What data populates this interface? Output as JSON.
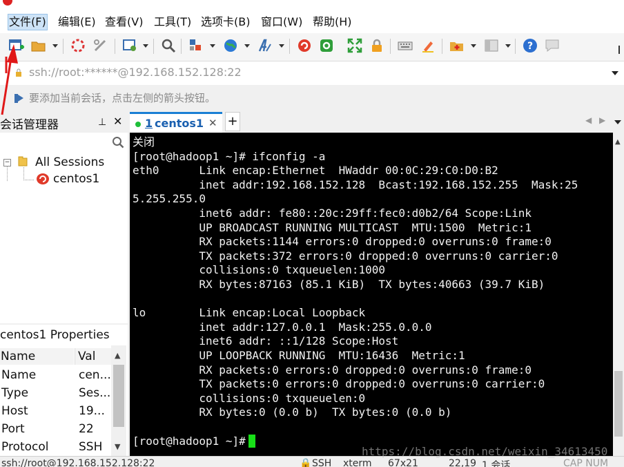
{
  "menu": [
    "文件(F)",
    "编辑(E)",
    "查看(V)",
    "工具(T)",
    "选项卡(B)",
    "窗口(W)",
    "帮助(H)"
  ],
  "address": {
    "value": "ssh://root:******@192.168.152.128:22"
  },
  "hint": "要添加当前会话，点击左侧的箭头按钮。",
  "session_manager": {
    "title": "会话管理器",
    "pin_glyph": "⊥",
    "close_glyph": "✕",
    "root": "All Sessions",
    "sessions": [
      "centos1"
    ]
  },
  "properties": {
    "title": "centos1 Properties",
    "headers": [
      "Name",
      "Val"
    ],
    "rows": [
      {
        "name": "Name",
        "value": "cen..."
      },
      {
        "name": "Type",
        "value": "Ses..."
      },
      {
        "name": "Host",
        "value": "19..."
      },
      {
        "name": "Port",
        "value": "22"
      },
      {
        "name": "Protocol",
        "value": "SSH"
      }
    ]
  },
  "tab": {
    "number": "1",
    "label": "centos1",
    "close_glyph": "✕",
    "add_glyph": "+"
  },
  "terminal": {
    "lines": [
      "关闭",
      "[root@hadoop1 ~]# ifconfig -a",
      "eth0      Link encap:Ethernet  HWaddr 00:0C:29:C0:D0:B2  ",
      "          inet addr:192.168.152.128  Bcast:192.168.152.255  Mask:25",
      "5.255.255.0",
      "          inet6 addr: fe80::20c:29ff:fec0:d0b2/64 Scope:Link",
      "          UP BROADCAST RUNNING MULTICAST  MTU:1500  Metric:1",
      "          RX packets:1144 errors:0 dropped:0 overruns:0 frame:0",
      "          TX packets:372 errors:0 dropped:0 overruns:0 carrier:0",
      "          collisions:0 txqueuelen:1000 ",
      "          RX bytes:87163 (85.1 KiB)  TX bytes:40663 (39.7 KiB)",
      "",
      "lo        Link encap:Local Loopback  ",
      "          inet addr:127.0.0.1  Mask:255.0.0.0",
      "          inet6 addr: ::1/128 Scope:Host",
      "          UP LOOPBACK RUNNING  MTU:16436  Metric:1",
      "          RX packets:0 errors:0 dropped:0 overruns:0 frame:0",
      "          TX packets:0 errors:0 dropped:0 overruns:0 carrier:0",
      "          collisions:0 txqueuelen:0 ",
      "          RX bytes:0 (0.0 b)  TX bytes:0 (0.0 b)"
    ],
    "prompt": "[root@hadoop1 ~]#"
  },
  "status": {
    "connection": "ssh://root@192.168.152.128:22",
    "protocol": "SSH",
    "terminal_type": "xterm",
    "size": "67x21",
    "position": "22,19",
    "sessions": "1 会话",
    "caps": "CAP NUM"
  },
  "watermark": "https://blog.csdn.net/weixin_34613450",
  "colors": {
    "accent": "#1a7fd4",
    "cursor": "#18e018",
    "annotation": "#e01818"
  }
}
